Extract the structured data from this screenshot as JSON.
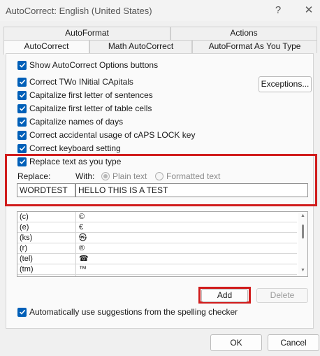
{
  "window": {
    "title": "AutoCorrect: English (United States)",
    "help_glyph": "?",
    "close_glyph": "✕"
  },
  "tabs": {
    "top": [
      "AutoFormat",
      "Actions"
    ],
    "bottom": [
      "AutoCorrect",
      "Math AutoCorrect",
      "AutoFormat As You Type"
    ],
    "active": "AutoCorrect"
  },
  "options": {
    "show_buttons": "Show AutoCorrect Options buttons",
    "two_initial": "Correct TWo INitial CApitals",
    "cap_sentences": "Capitalize first letter of sentences",
    "cap_table": "Capitalize first letter of table cells",
    "cap_days": "Capitalize names of days",
    "caps_lock": "Correct accidental usage of cAPS LOCK key",
    "keyboard": "Correct keyboard setting",
    "replace_text": "Replace text as you type",
    "auto_suggest": "Automatically use suggestions from the spelling checker"
  },
  "buttons": {
    "exceptions": "Exceptions...",
    "add": "Add",
    "delete": "Delete",
    "ok": "OK",
    "cancel": "Cancel"
  },
  "replace": {
    "replace_label": "Replace:",
    "with_label": "With:",
    "plain_text": "Plain text",
    "formatted_text": "Formatted text",
    "replace_value": "WORDTEST",
    "with_value": "HELLO THIS IS A TEST"
  },
  "entries": [
    {
      "from": "(c)",
      "to": "©"
    },
    {
      "from": "(e)",
      "to": "€"
    },
    {
      "from": "(ks)",
      "to": "㉿"
    },
    {
      "from": "(r)",
      "to": "®"
    },
    {
      "from": "(tel)",
      "to": "☎"
    },
    {
      "from": "(tm)",
      "to": "™"
    }
  ],
  "colors": {
    "accent": "#005fb8",
    "highlight": "#d01c1c"
  }
}
